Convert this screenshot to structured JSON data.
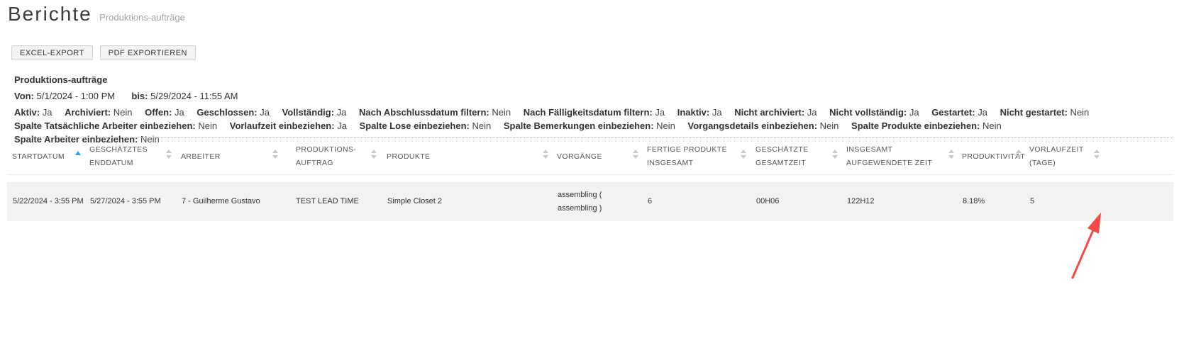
{
  "header": {
    "title": "Berichte",
    "subtitle": "Produktions-aufträge"
  },
  "toolbar": {
    "excel_label": "EXCEL-EXPORT",
    "pdf_label": "PDF EXPORTIEREN"
  },
  "report": {
    "name": "Produktions-aufträge",
    "from_label": "Von:",
    "from_value": "5/1/2024 - 1:00 PM",
    "to_label": "bis:",
    "to_value": "5/29/2024 - 11:55 AM",
    "filters": [
      {
        "key": "Aktiv:",
        "value": "Ja"
      },
      {
        "key": "Archiviert:",
        "value": "Nein"
      },
      {
        "key": "Offen:",
        "value": "Ja"
      },
      {
        "key": "Geschlossen:",
        "value": "Ja"
      },
      {
        "key": "Vollständig:",
        "value": "Ja"
      },
      {
        "key": "Nach Abschlussdatum filtern:",
        "value": "Nein"
      },
      {
        "key": "Nach Fälligkeitsdatum filtern:",
        "value": "Ja"
      },
      {
        "key": "Inaktiv:",
        "value": "Ja"
      },
      {
        "key": "Nicht archiviert:",
        "value": "Ja"
      },
      {
        "key": "Nicht vollständig:",
        "value": "Ja"
      },
      {
        "key": "Gestartet:",
        "value": "Ja"
      },
      {
        "key": "Nicht gestartet:",
        "value": "Nein"
      },
      {
        "key": "Spalte Tatsächliche Arbeiter einbeziehen:",
        "value": "Nein"
      },
      {
        "key": "Vorlaufzeit einbeziehen:",
        "value": "Ja"
      },
      {
        "key": "Spalte Lose einbeziehen:",
        "value": "Nein"
      },
      {
        "key": "Spalte Bemerkungen einbeziehen:",
        "value": "Nein"
      },
      {
        "key": "Vorgangsdetails einbeziehen:",
        "value": "Nein"
      },
      {
        "key": "Spalte Produkte einbeziehen:",
        "value": "Nein"
      },
      {
        "key": "Spalte Arbeiter einbeziehen:",
        "value": "Nein"
      }
    ]
  },
  "table": {
    "columns": [
      {
        "label": "STARTDATUM"
      },
      {
        "label": "GESCHÄTZTES ENDDATUM"
      },
      {
        "label": "ARBEITER"
      },
      {
        "label": "PRODUKTIONS-AUFTRAG"
      },
      {
        "label": "PRODUKTE"
      },
      {
        "label": "VORGÄNGE"
      },
      {
        "label": "FERTIGE PRODUKTE INSGESAMT"
      },
      {
        "label": "GESCHÄTZTE GESAMTZEIT"
      },
      {
        "label": "INSGESAMT AUFGEWENDETE ZEIT"
      },
      {
        "label": "PRODUKTIVITÄT"
      },
      {
        "label": "VORLAUFZEIT (TAGE)"
      }
    ],
    "sort": {
      "column": "STARTDATUM",
      "direction": "ascending"
    },
    "rows": [
      [
        "5/22/2024 - 3:55 PM",
        "5/27/2024 - 3:55 PM",
        "7 - Guilherme Gustavo",
        "TEST LEAD TIME",
        "Simple Closet 2",
        "assembling ( assembling )",
        "6",
        "00H06",
        "122H12",
        "8.18%",
        "5"
      ]
    ]
  },
  "colors": {
    "sort_accent": "#2f9ee0",
    "annotation_arrow": "#f04a48",
    "row_background": "#f2f2f2"
  },
  "icons": [
    "sort-ascending-icon",
    "sort-icon",
    "annotation-arrow-icon"
  ]
}
